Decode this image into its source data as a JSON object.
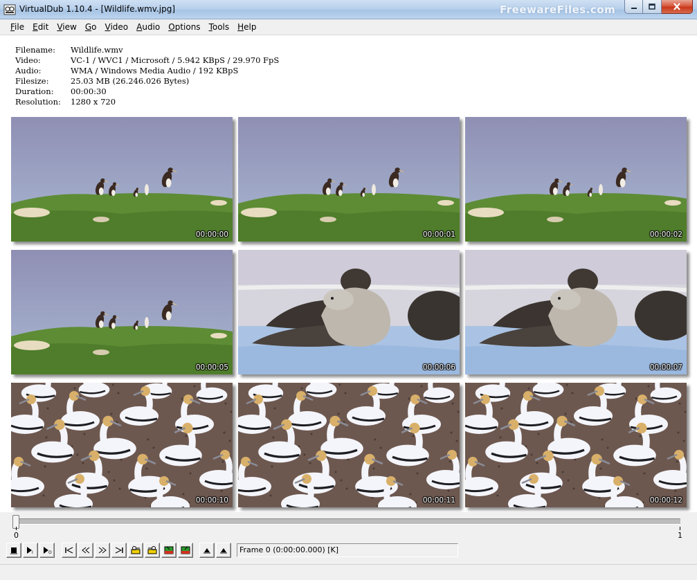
{
  "window": {
    "title": "VirtualDub 1.10.4 - [Wildlife.wmv.jpg]",
    "watermark": "FreewareFiles.com"
  },
  "menu": [
    {
      "label": "File",
      "ul": "F",
      "rest": "ile"
    },
    {
      "label": "Edit",
      "ul": "E",
      "rest": "dit"
    },
    {
      "label": "View",
      "ul": "V",
      "rest": "iew"
    },
    {
      "label": "Go",
      "ul": "G",
      "rest": "o"
    },
    {
      "label": "Video",
      "ul": "V",
      "rest": "ideo"
    },
    {
      "label": "Audio",
      "ul": "A",
      "rest": "udio"
    },
    {
      "label": "Options",
      "ul": "O",
      "rest": "ptions"
    },
    {
      "label": "Tools",
      "ul": "T",
      "rest": "ools"
    },
    {
      "label": "Help",
      "ul": "H",
      "rest": "elp"
    }
  ],
  "info": [
    {
      "label": "Filename:",
      "value": "Wildlife.wmv"
    },
    {
      "label": "Video:",
      "value": "VC-1 / WVC1 / Microsoft / 5.942 KBpS / 29.970 FpS"
    },
    {
      "label": "Audio:",
      "value": "WMA / Windows Media Audio / 192 KBpS"
    },
    {
      "label": "Filesize:",
      "value": "25.03 MB (26.246.026 Bytes)"
    },
    {
      "label": "Duration:",
      "value": "00:00:30"
    },
    {
      "label": "Resolution:",
      "value": "1280 x 720"
    }
  ],
  "thumbnails": [
    {
      "timestamp": "00:00:00",
      "scene": "boobies"
    },
    {
      "timestamp": "00:00:01",
      "scene": "boobies"
    },
    {
      "timestamp": "00:00:02",
      "scene": "boobies"
    },
    {
      "timestamp": "00:00:05",
      "scene": "boobies"
    },
    {
      "timestamp": "00:00:06",
      "scene": "seals"
    },
    {
      "timestamp": "00:00:07",
      "scene": "seals"
    },
    {
      "timestamp": "00:00:10",
      "scene": "gannets"
    },
    {
      "timestamp": "00:00:11",
      "scene": "gannets"
    },
    {
      "timestamp": "00:00:12",
      "scene": "gannets"
    }
  ],
  "timeline": {
    "start_label": "0",
    "end_label": "1",
    "position": 0
  },
  "status": {
    "frame_text": "Frame 0 (0:00:00.000) [K]"
  },
  "colors": {
    "title_gradient_top": "#cfe0f3",
    "close_button": "#c8381a",
    "face": "#f0f0f0"
  }
}
